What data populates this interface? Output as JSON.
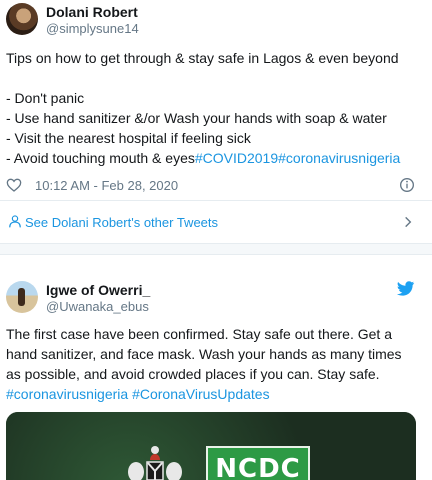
{
  "tweet1": {
    "name": "Dolani Robert",
    "handle": "@simplysune14",
    "lines": [
      "Tips on how to get through & stay safe in Lagos & even beyond",
      "",
      "- Don't panic",
      "- Use hand sanitizer &/or Wash your hands with soap & water",
      "- Visit the nearest hospital if feeling sick",
      "- Avoid touching mouth & eyes"
    ],
    "hashtags": [
      "#COVID2019",
      "#coronavirusnigeria"
    ],
    "timestamp": "10:12 AM - Feb 28, 2020",
    "see_more": "See Dolani Robert's other Tweets"
  },
  "tweet2": {
    "name": "Igwe of Owerri_",
    "handle": "@Uwanaka_ebus",
    "lines": [
      "The first case have been confirmed. Stay safe out there. Get a",
      "hand sanitizer, and face mask. Wash your hands as many times",
      "as possible, and avoid crowded places if you can. Stay safe."
    ],
    "hashtags": [
      "#coronavirusnigeria",
      "#CoronaVirusUpdates"
    ],
    "media_text": "NCDC"
  },
  "icons": {
    "heart": "heart-icon",
    "info": "info-icon",
    "user": "user-icon",
    "chevron": "chevron-right-icon",
    "bird": "twitter-bird-icon"
  },
  "colors": {
    "link": "#1b95e0",
    "secondary": "#657786",
    "text": "#14171a",
    "ncdc_green": "#2d9a45"
  }
}
